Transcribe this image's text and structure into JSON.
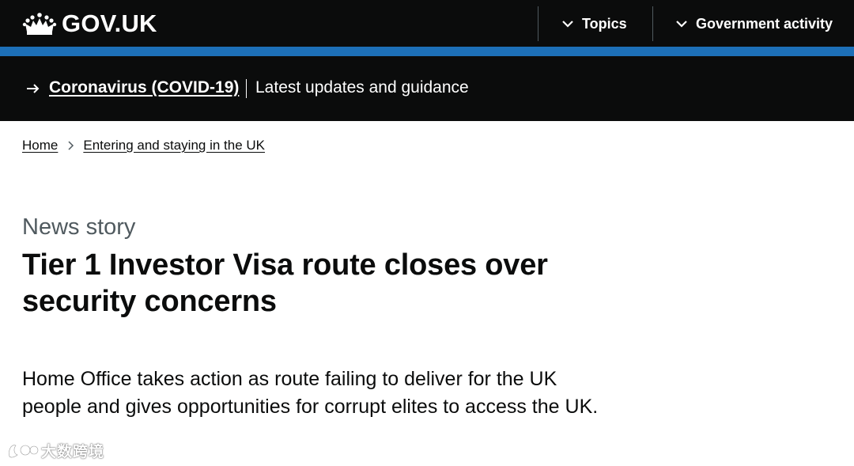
{
  "header": {
    "logo_text": "GOV.UK",
    "nav": [
      {
        "label": "Topics",
        "icon": "chevron-down-icon"
      },
      {
        "label": "Government activity",
        "icon": "chevron-down-icon"
      }
    ],
    "colors": {
      "header_bg": "#0b0c0c",
      "accent_bar": "#1d70b8"
    }
  },
  "banner": {
    "icon": "arrow-right-icon",
    "link_label": "Coronavirus (COVID-19)",
    "text": "Latest updates and guidance"
  },
  "breadcrumb": [
    {
      "label": "Home"
    },
    {
      "label": "Entering and staying in the UK"
    }
  ],
  "article": {
    "caption": "News story",
    "title": "Tier 1 Investor Visa route closes over security concerns",
    "lead": "Home Office takes action as route failing to deliver for the UK people and gives opportunities for corrupt elites to access the UK."
  },
  "watermark": {
    "text": "大数跨境"
  }
}
